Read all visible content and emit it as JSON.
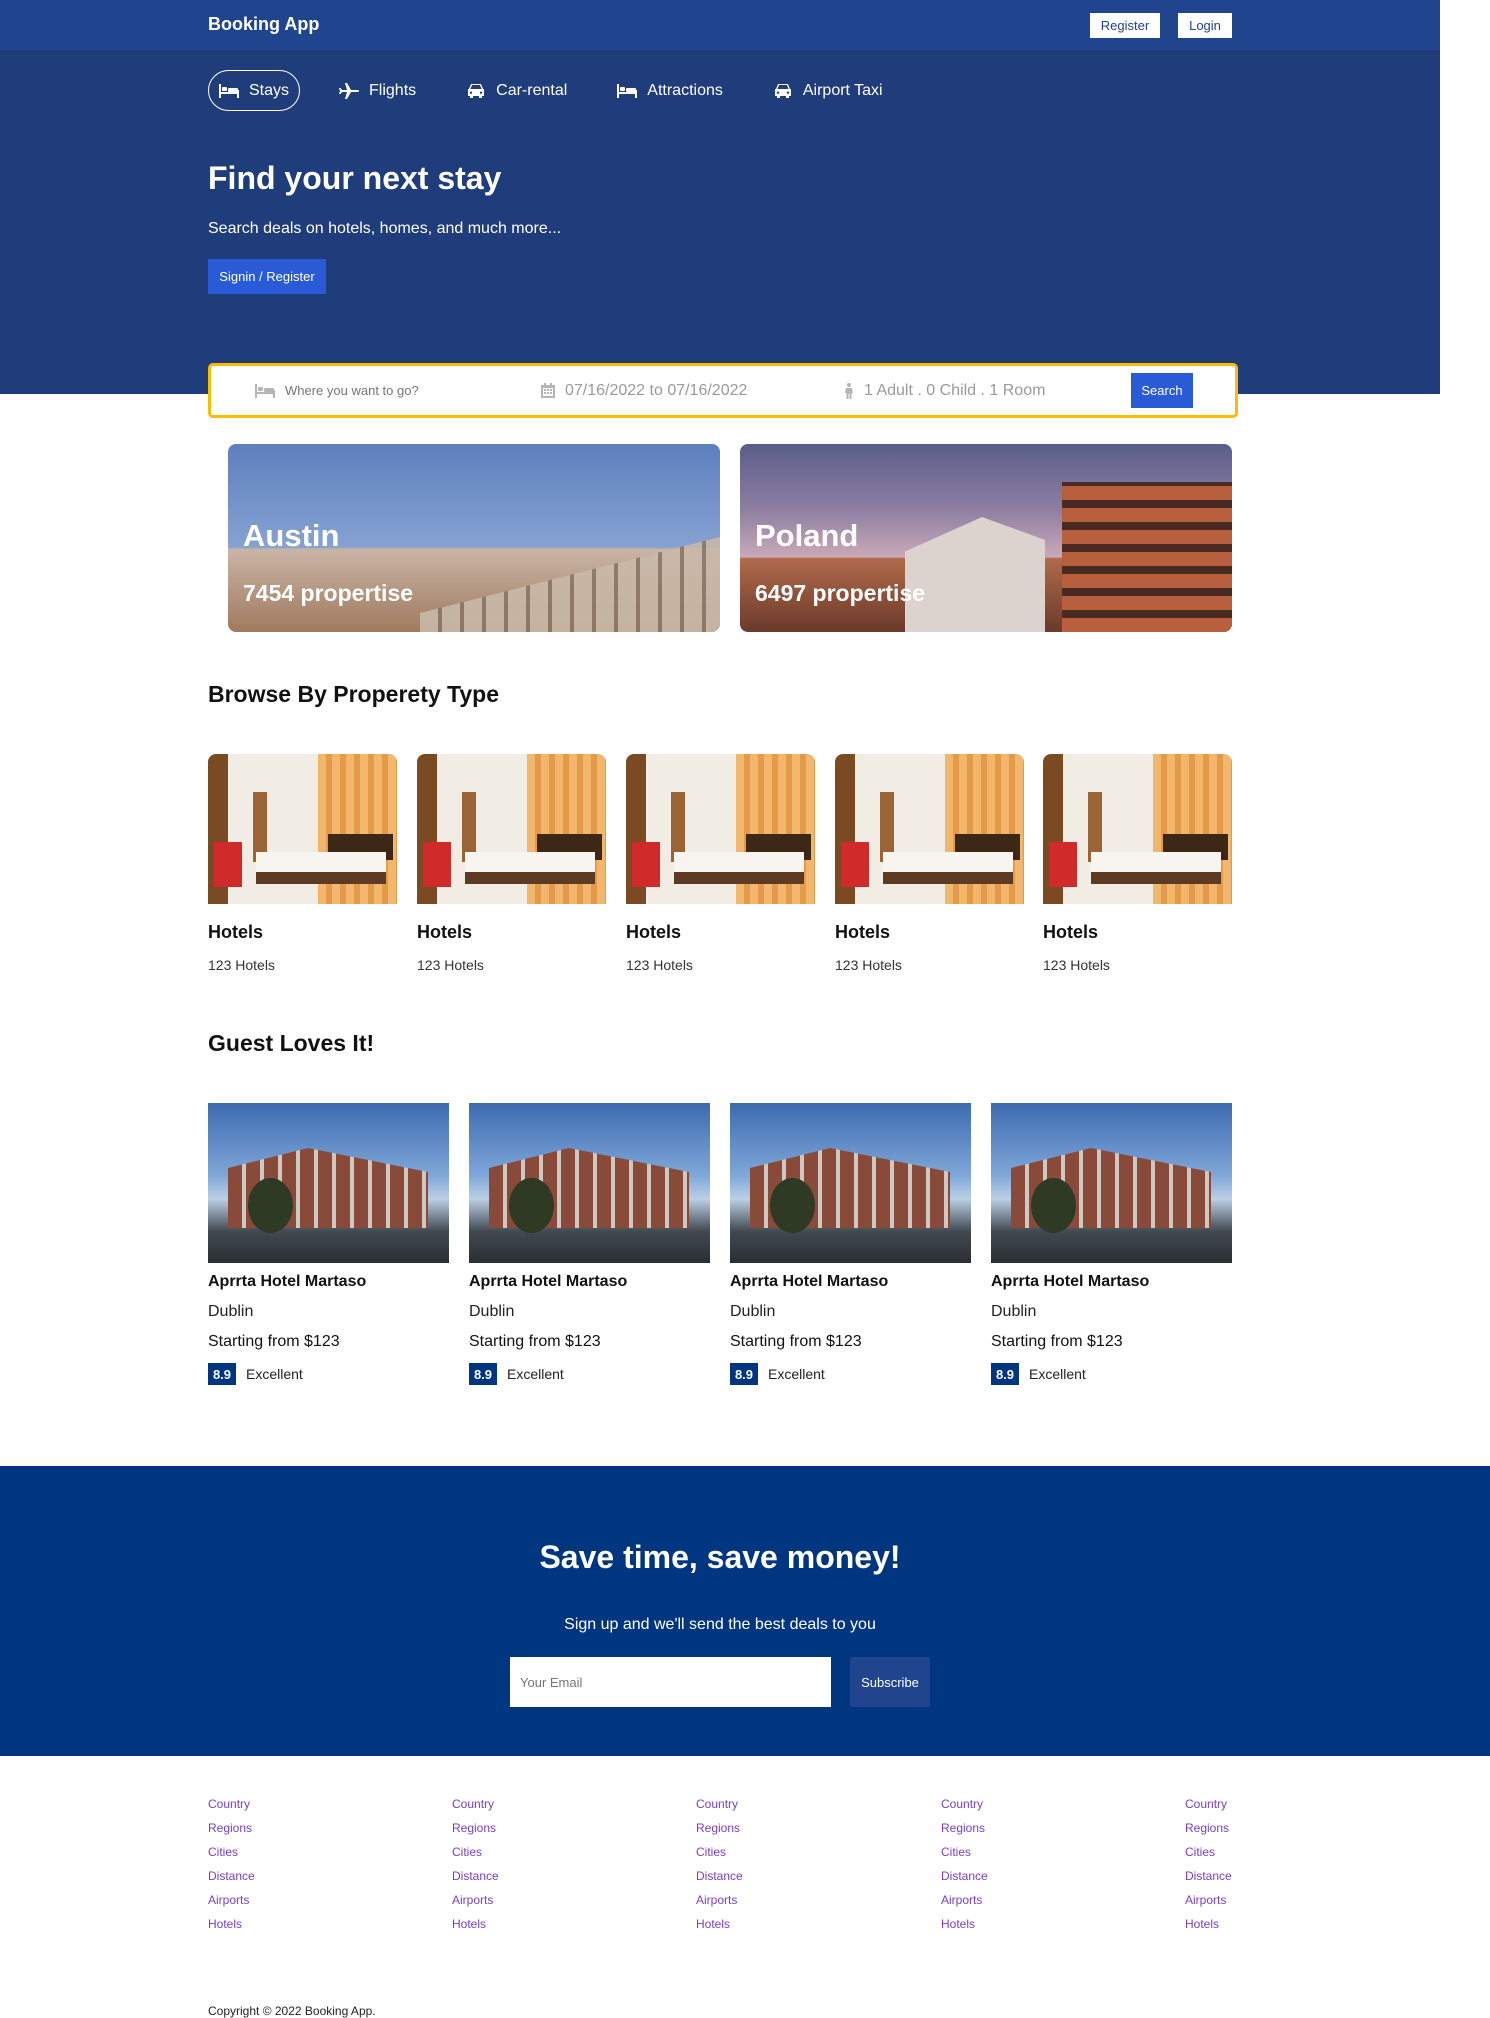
{
  "topbar": {
    "brand": "Booking App",
    "register_label": "Register",
    "login_label": "Login"
  },
  "tabs": [
    {
      "label": "Stays",
      "icon": "bed-icon",
      "active": true
    },
    {
      "label": "Flights",
      "icon": "plane-icon",
      "active": false
    },
    {
      "label": "Car-rental",
      "icon": "car-icon",
      "active": false
    },
    {
      "label": "Attractions",
      "icon": "bed-icon",
      "active": false
    },
    {
      "label": "Airport Taxi",
      "icon": "taxi-icon",
      "active": false
    }
  ],
  "hero": {
    "title": "Find your next stay",
    "subtitle": "Search deals on hotels, homes, and much more...",
    "cta_label": "Signin / Register"
  },
  "search": {
    "destination_placeholder": "Where you want to go?",
    "dates": "07/16/2022 to 07/16/2022",
    "guests": "1 Adult . 0 Child . 1 Room",
    "button_label": "Search"
  },
  "featured": [
    {
      "city": "Austin",
      "count": "7454 propertise"
    },
    {
      "city": "Poland",
      "count": "6497 propertise"
    }
  ],
  "property_types": {
    "title": "Browse By Properety Type",
    "items": [
      {
        "name": "Hotels",
        "count": "123 Hotels"
      },
      {
        "name": "Hotels",
        "count": "123 Hotels"
      },
      {
        "name": "Hotels",
        "count": "123 Hotels"
      },
      {
        "name": "Hotels",
        "count": "123 Hotels"
      },
      {
        "name": "Hotels",
        "count": "123 Hotels"
      }
    ]
  },
  "guest_loves": {
    "title": "Guest Loves It!",
    "items": [
      {
        "name": "Aprrta Hotel Martaso",
        "city": "Dublin",
        "price": "Starting from $123",
        "score": "8.9",
        "rating": "Excellent"
      },
      {
        "name": "Aprrta Hotel Martaso",
        "city": "Dublin",
        "price": "Starting from $123",
        "score": "8.9",
        "rating": "Excellent"
      },
      {
        "name": "Aprrta Hotel Martaso",
        "city": "Dublin",
        "price": "Starting from $123",
        "score": "8.9",
        "rating": "Excellent"
      },
      {
        "name": "Aprrta Hotel Martaso",
        "city": "Dublin",
        "price": "Starting from $123",
        "score": "8.9",
        "rating": "Excellent"
      }
    ]
  },
  "newsletter": {
    "title": "Save time, save money!",
    "subtitle": "Sign up and we'll send the best deals to you",
    "email_placeholder": "Your Email",
    "button_label": "Subscribe"
  },
  "footer": {
    "columns": [
      [
        "Country",
        "Regions",
        "Cities",
        "Distance",
        "Airports",
        "Hotels"
      ],
      [
        "Country",
        "Regions",
        "Cities",
        "Distance",
        "Airports",
        "Hotels"
      ],
      [
        "Country",
        "Regions",
        "Cities",
        "Distance",
        "Airports",
        "Hotels"
      ],
      [
        "Country",
        "Regions",
        "Cities",
        "Distance",
        "Airports",
        "Hotels"
      ],
      [
        "Country",
        "Regions",
        "Cities",
        "Distance",
        "Airports",
        "Hotels"
      ]
    ],
    "copyright": "Copyright © 2022 Booking App."
  },
  "colors": {
    "header": "#1f3d7a",
    "topbar": "#21448f",
    "accent": "#2a5bd7",
    "searchbar_border": "#febb02",
    "newsletter": "#003580",
    "footer_link": "#7a3dcc"
  }
}
